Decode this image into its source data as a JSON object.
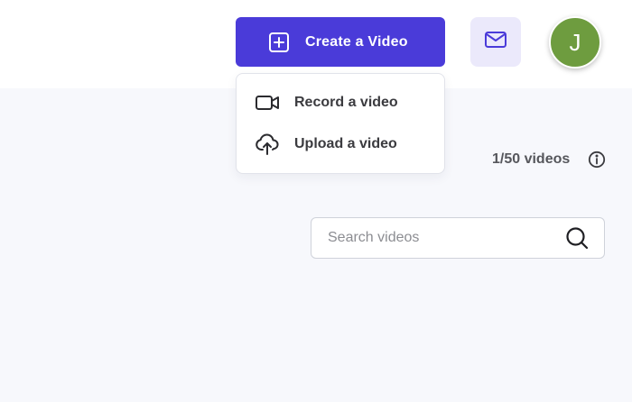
{
  "header": {
    "create_button_label": "Create a Video",
    "avatar_initial": "J"
  },
  "create_menu": {
    "items": [
      {
        "label": "Record a video",
        "icon": "video-camera-icon"
      },
      {
        "label": "Upload a video",
        "icon": "cloud-upload-icon"
      }
    ]
  },
  "videos": {
    "count_text": "1/50 videos"
  },
  "search": {
    "placeholder": "Search videos",
    "value": ""
  },
  "colors": {
    "primary": "#4a3bd9",
    "mail_button_bg": "#ebe9fb",
    "avatar_bg": "#6e9c3f",
    "page_bg": "#f7f8fc"
  }
}
